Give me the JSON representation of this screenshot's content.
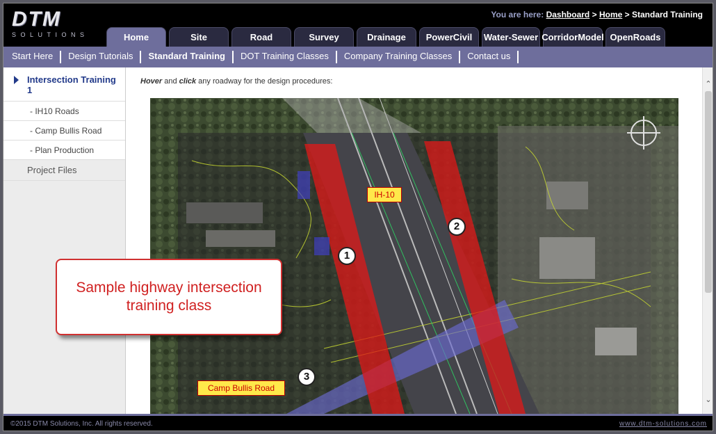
{
  "logo": {
    "main": "DTM",
    "sub": "SOLUTIONS"
  },
  "breadcrumb": {
    "prefix": "You are here:",
    "dashboard": "Dashboard",
    "sep1": " > ",
    "home": "Home",
    "sep2": " > ",
    "current": "Standard Training"
  },
  "tabs": [
    "Home",
    "Site",
    "Road",
    "Survey",
    "Drainage",
    "PowerCivil",
    "Water-Sewer",
    "CorridorModel",
    "OpenRoads"
  ],
  "active_tab": "Home",
  "subnav": [
    "Start Here",
    "Design Tutorials",
    "Standard Training",
    "DOT Training Classes",
    "Company Training Classes",
    "Contact us"
  ],
  "sidebar": {
    "active": "Intersection Training 1",
    "subitems": [
      "- IH10 Roads",
      "- Camp Bullis Road",
      "- Plan Production"
    ],
    "other": "Project Files"
  },
  "instruction": {
    "hover": "Hover",
    "and": " and ",
    "click": "click",
    "rest": " any roadway for the design procedures:"
  },
  "map": {
    "label_ih10": "IH-10",
    "label_camp": "Camp Bullis Road",
    "markers": [
      "1",
      "2",
      "3"
    ]
  },
  "callout": "Sample highway intersection training class",
  "footer": {
    "copyright": "©2015 DTM Solutions, Inc. All rights reserved.",
    "site": "www.dtm-solutions.com"
  },
  "colors": {
    "nav": "#6e6e9c",
    "road_red": "#e01818",
    "road_blue": "#6a6ad0",
    "callout_text": "#d02020"
  }
}
